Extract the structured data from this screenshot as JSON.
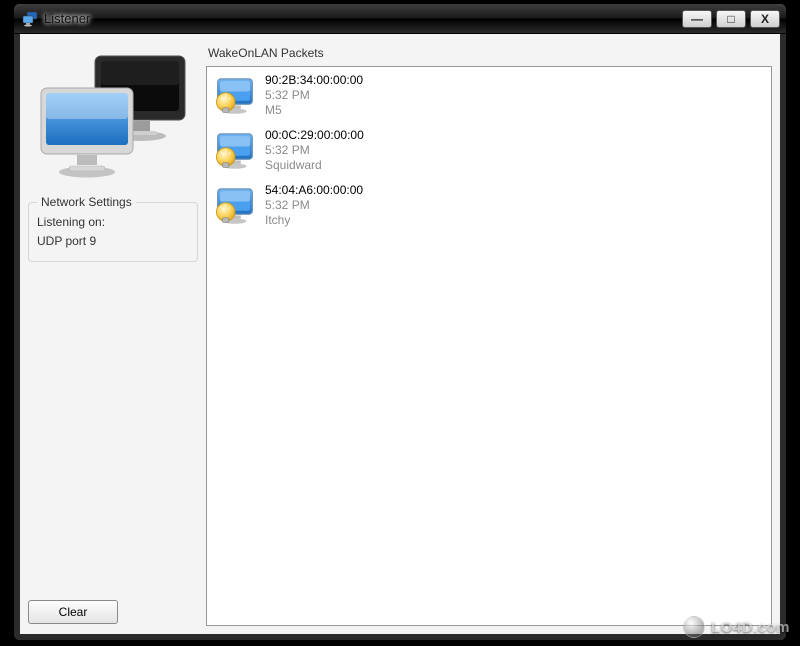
{
  "window": {
    "title": "Listener",
    "buttons": {
      "min": "—",
      "max": "□",
      "close": "X"
    }
  },
  "sidebar": {
    "group_title": "Network Settings",
    "line1": "Listening on:",
    "line2": "UDP port 9",
    "clear_label": "Clear"
  },
  "main": {
    "header": "WakeOnLAN Packets",
    "packets": [
      {
        "mac": "90:2B:34:00:00:00",
        "time": "5:32 PM",
        "name": "M5"
      },
      {
        "mac": "00:0C:29:00:00:00",
        "time": "5:32 PM",
        "name": "Squidward"
      },
      {
        "mac": "54:04:A6:00:00:00",
        "time": "5:32 PM",
        "name": "Itchy"
      }
    ]
  },
  "watermark": "LO4D.com",
  "colors": {
    "monitor_blue": "#2f81d8",
    "monitor_dark": "#1a1a1a",
    "bulb": "#f6c43a"
  }
}
